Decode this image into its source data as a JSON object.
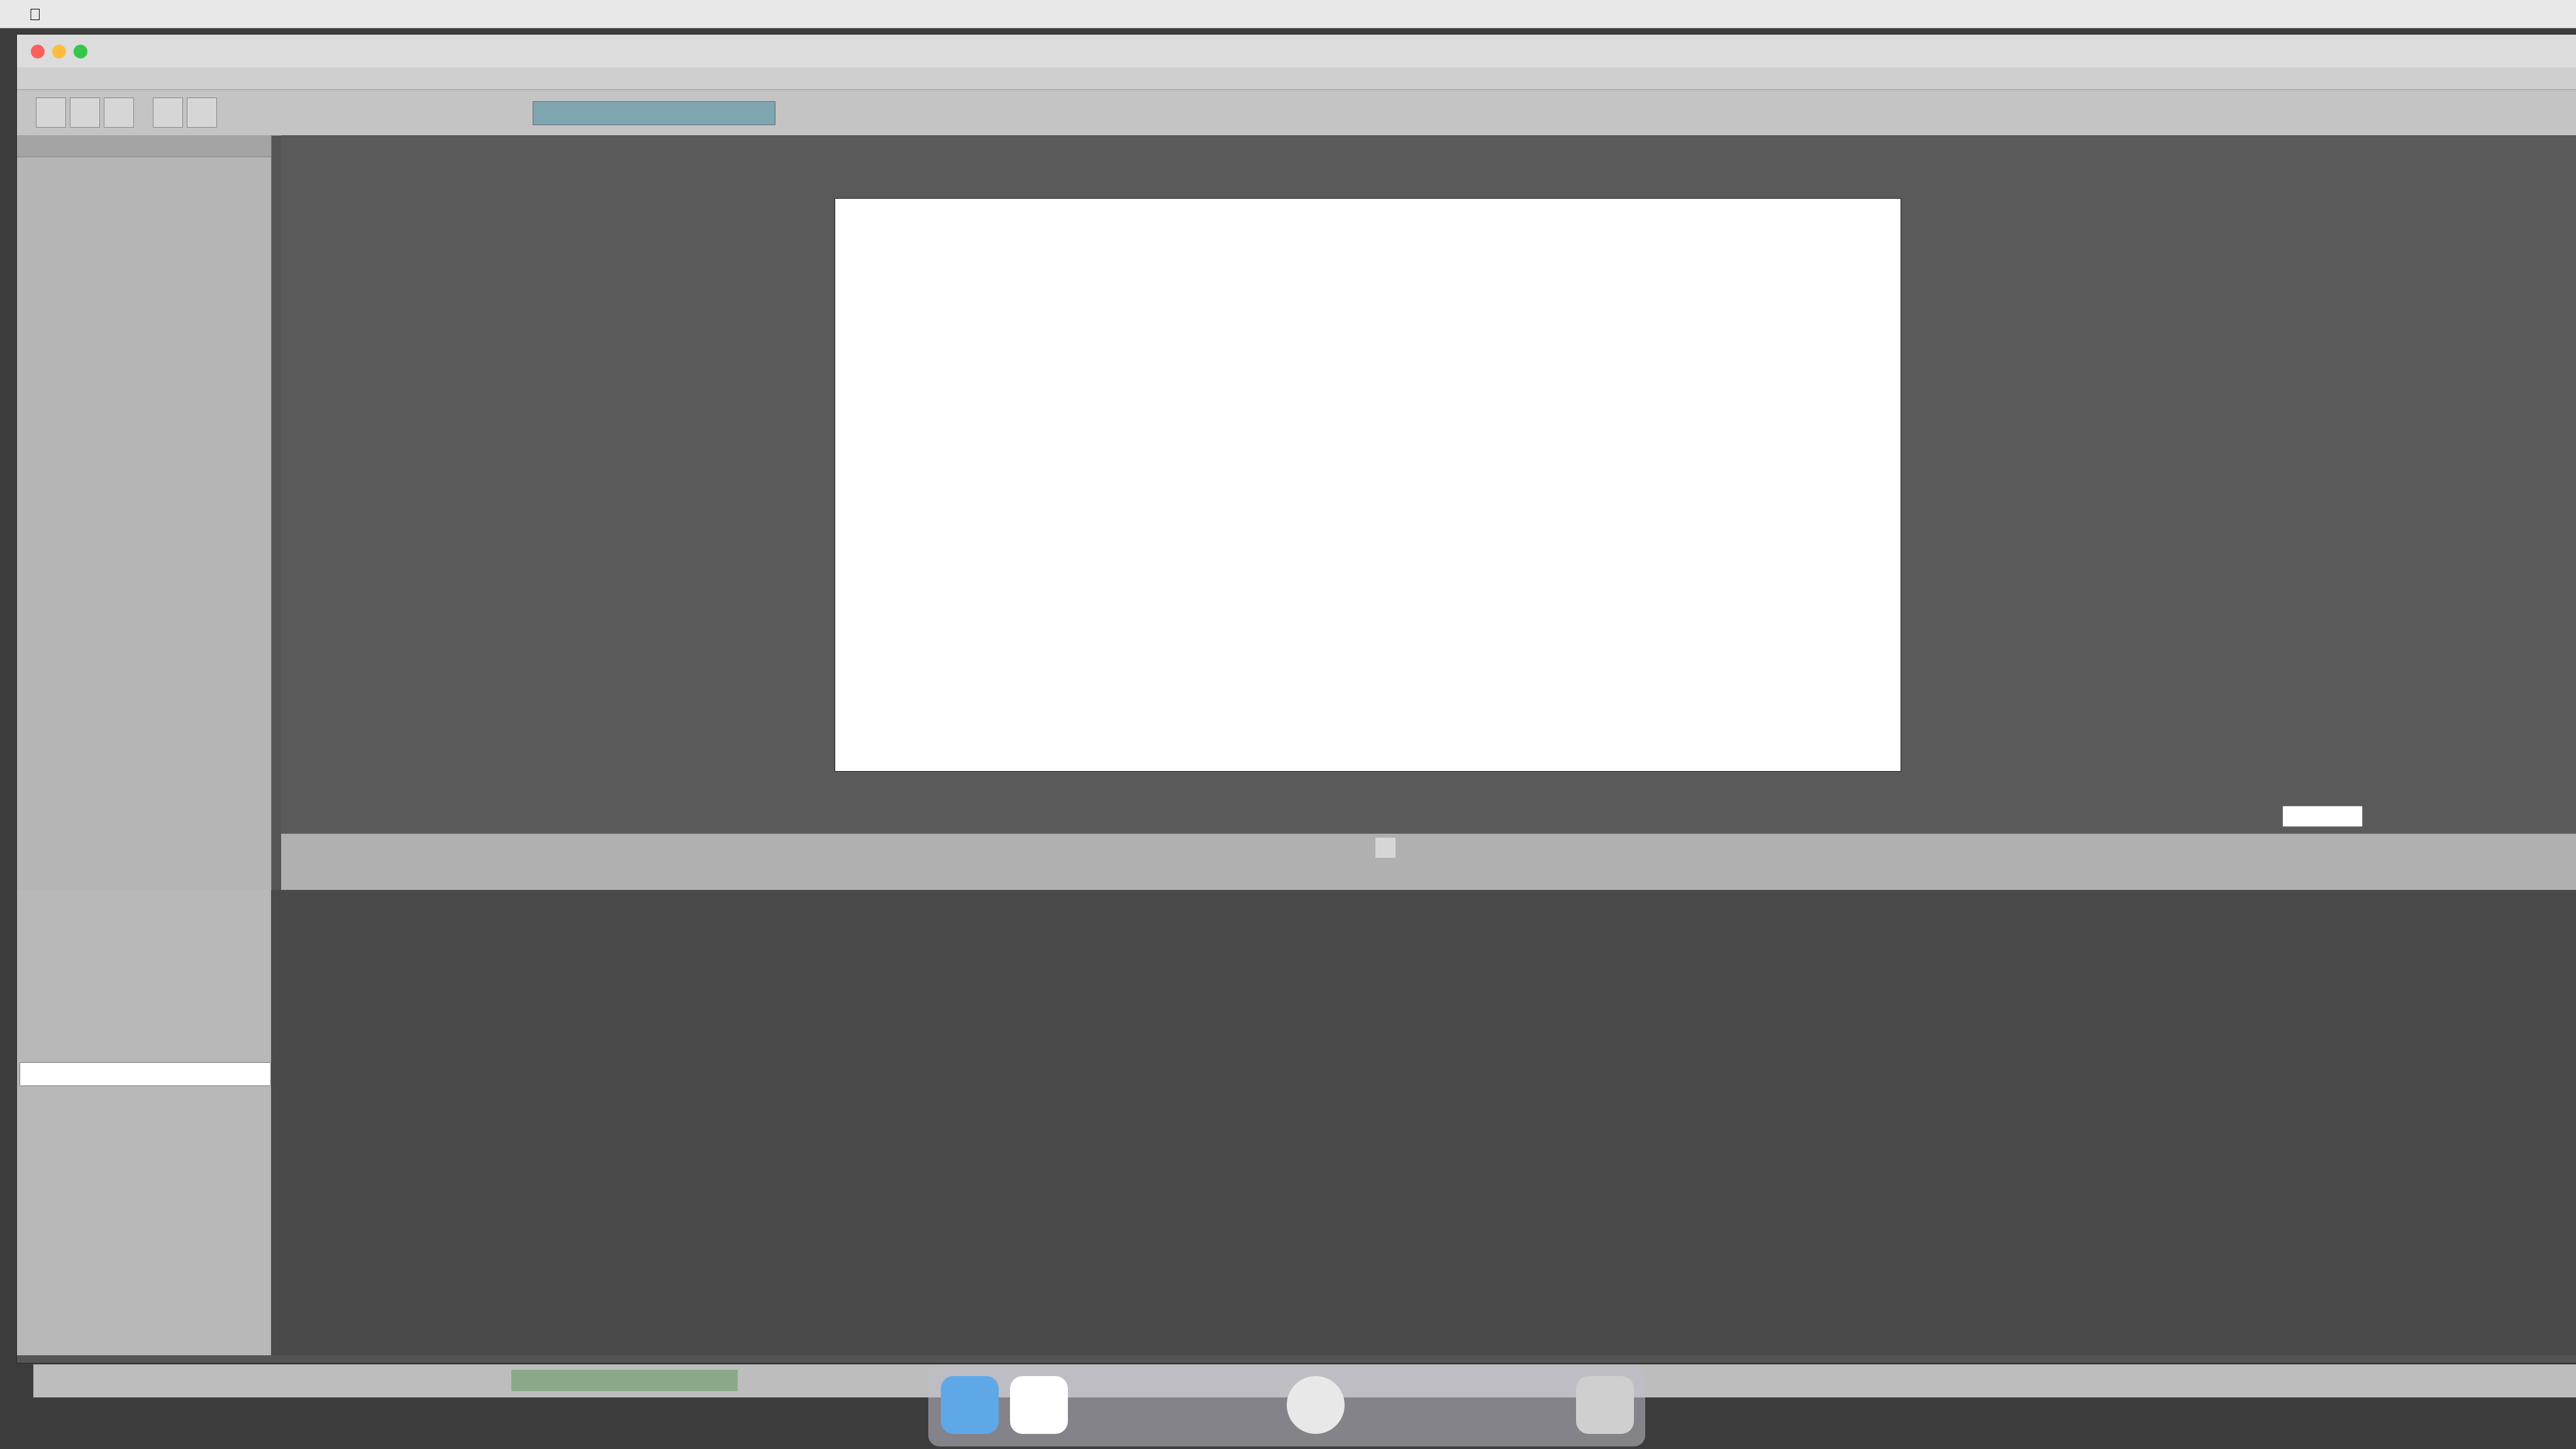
{
  "os_menubar": {
    "app_name": "",
    "items": [],
    "clock": ""
  },
  "window": {
    "title": "",
    "menu": []
  },
  "toolbar": {
    "search_value": ""
  },
  "left_panel": {
    "main_panel_title": "",
    "color_panel_title": "",
    "tool_panel_title": ""
  },
  "viewport": {
    "header_info": "",
    "zoom": ""
  },
  "transport": {
    "mark_in_label": "",
    "mark_out_label": "",
    "fps": ""
  },
  "project_panel": {
    "clip_info": "",
    "layer_info": "",
    "current_image": "",
    "clips": []
  },
  "properties": {
    "name_label": "",
    "name_value": "",
    "author_label": "",
    "author_value": ""
  },
  "statusbar": {
    "coords": "",
    "color_values": "",
    "proxy": ""
  }
}
